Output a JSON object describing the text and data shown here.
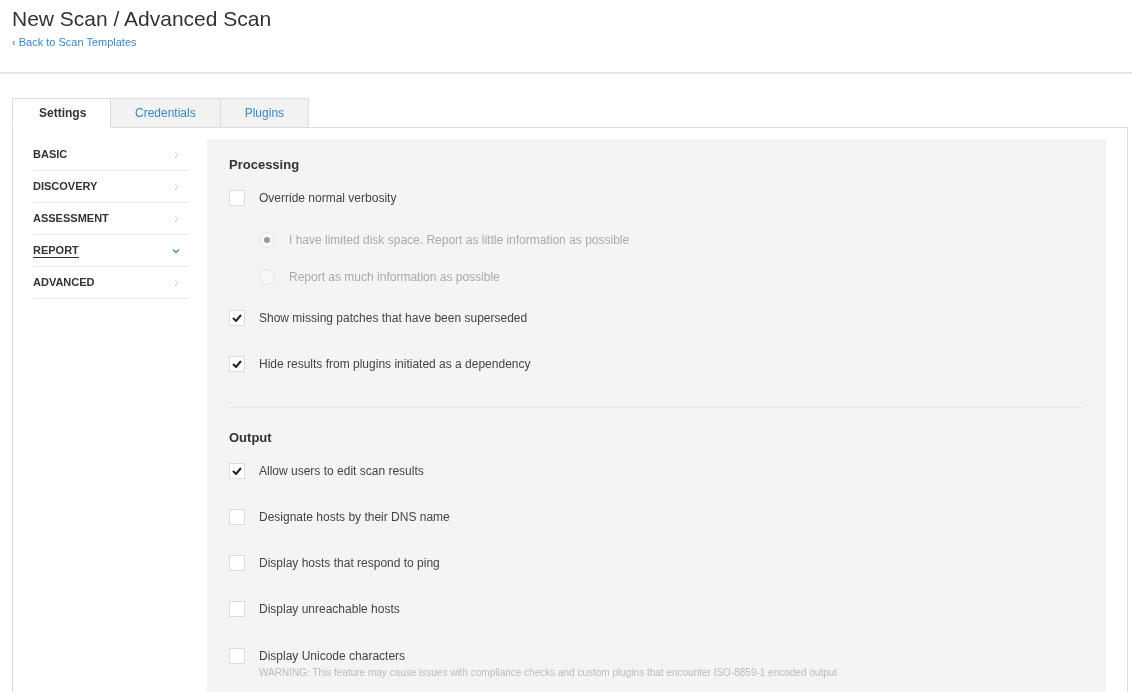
{
  "header": {
    "title": "New Scan / Advanced Scan",
    "back_link": "‹ Back to Scan Templates"
  },
  "tabs": [
    {
      "label": "Settings",
      "selected": true
    },
    {
      "label": "Credentials",
      "selected": false
    },
    {
      "label": "Plugins",
      "selected": false
    }
  ],
  "sidebar": {
    "items": [
      {
        "label": "BASIC",
        "selected": false
      },
      {
        "label": "DISCOVERY",
        "selected": false
      },
      {
        "label": "ASSESSMENT",
        "selected": false
      },
      {
        "label": "REPORT",
        "selected": true
      },
      {
        "label": "ADVANCED",
        "selected": false
      }
    ]
  },
  "sections": [
    {
      "title": "Processing",
      "options": [
        {
          "kind": "checkbox",
          "label": "Override normal verbosity",
          "checked": false,
          "children": [
            {
              "kind": "radio",
              "label": "I have limited disk space. Report as little information as possible",
              "selected": true,
              "disabled": true
            },
            {
              "kind": "radio",
              "label": "Report as much information as possible",
              "selected": false,
              "disabled": true
            }
          ]
        },
        {
          "kind": "checkbox",
          "label": "Show missing patches that have been superseded",
          "checked": true
        },
        {
          "kind": "checkbox",
          "label": "Hide results from plugins initiated as a dependency",
          "checked": true
        }
      ]
    },
    {
      "title": "Output",
      "options": [
        {
          "kind": "checkbox",
          "label": "Allow users to edit scan results",
          "checked": true
        },
        {
          "kind": "checkbox",
          "label": "Designate hosts by their DNS name",
          "checked": false
        },
        {
          "kind": "checkbox",
          "label": "Display hosts that respond to ping",
          "checked": false
        },
        {
          "kind": "checkbox",
          "label": "Display unreachable hosts",
          "checked": false
        },
        {
          "kind": "checkbox",
          "label": "Display Unicode characters",
          "checked": false,
          "note": "WARNING: This feature may cause issues with compliance checks and custom plugins that encounter ISO-8859-1 encoded output"
        }
      ]
    }
  ]
}
